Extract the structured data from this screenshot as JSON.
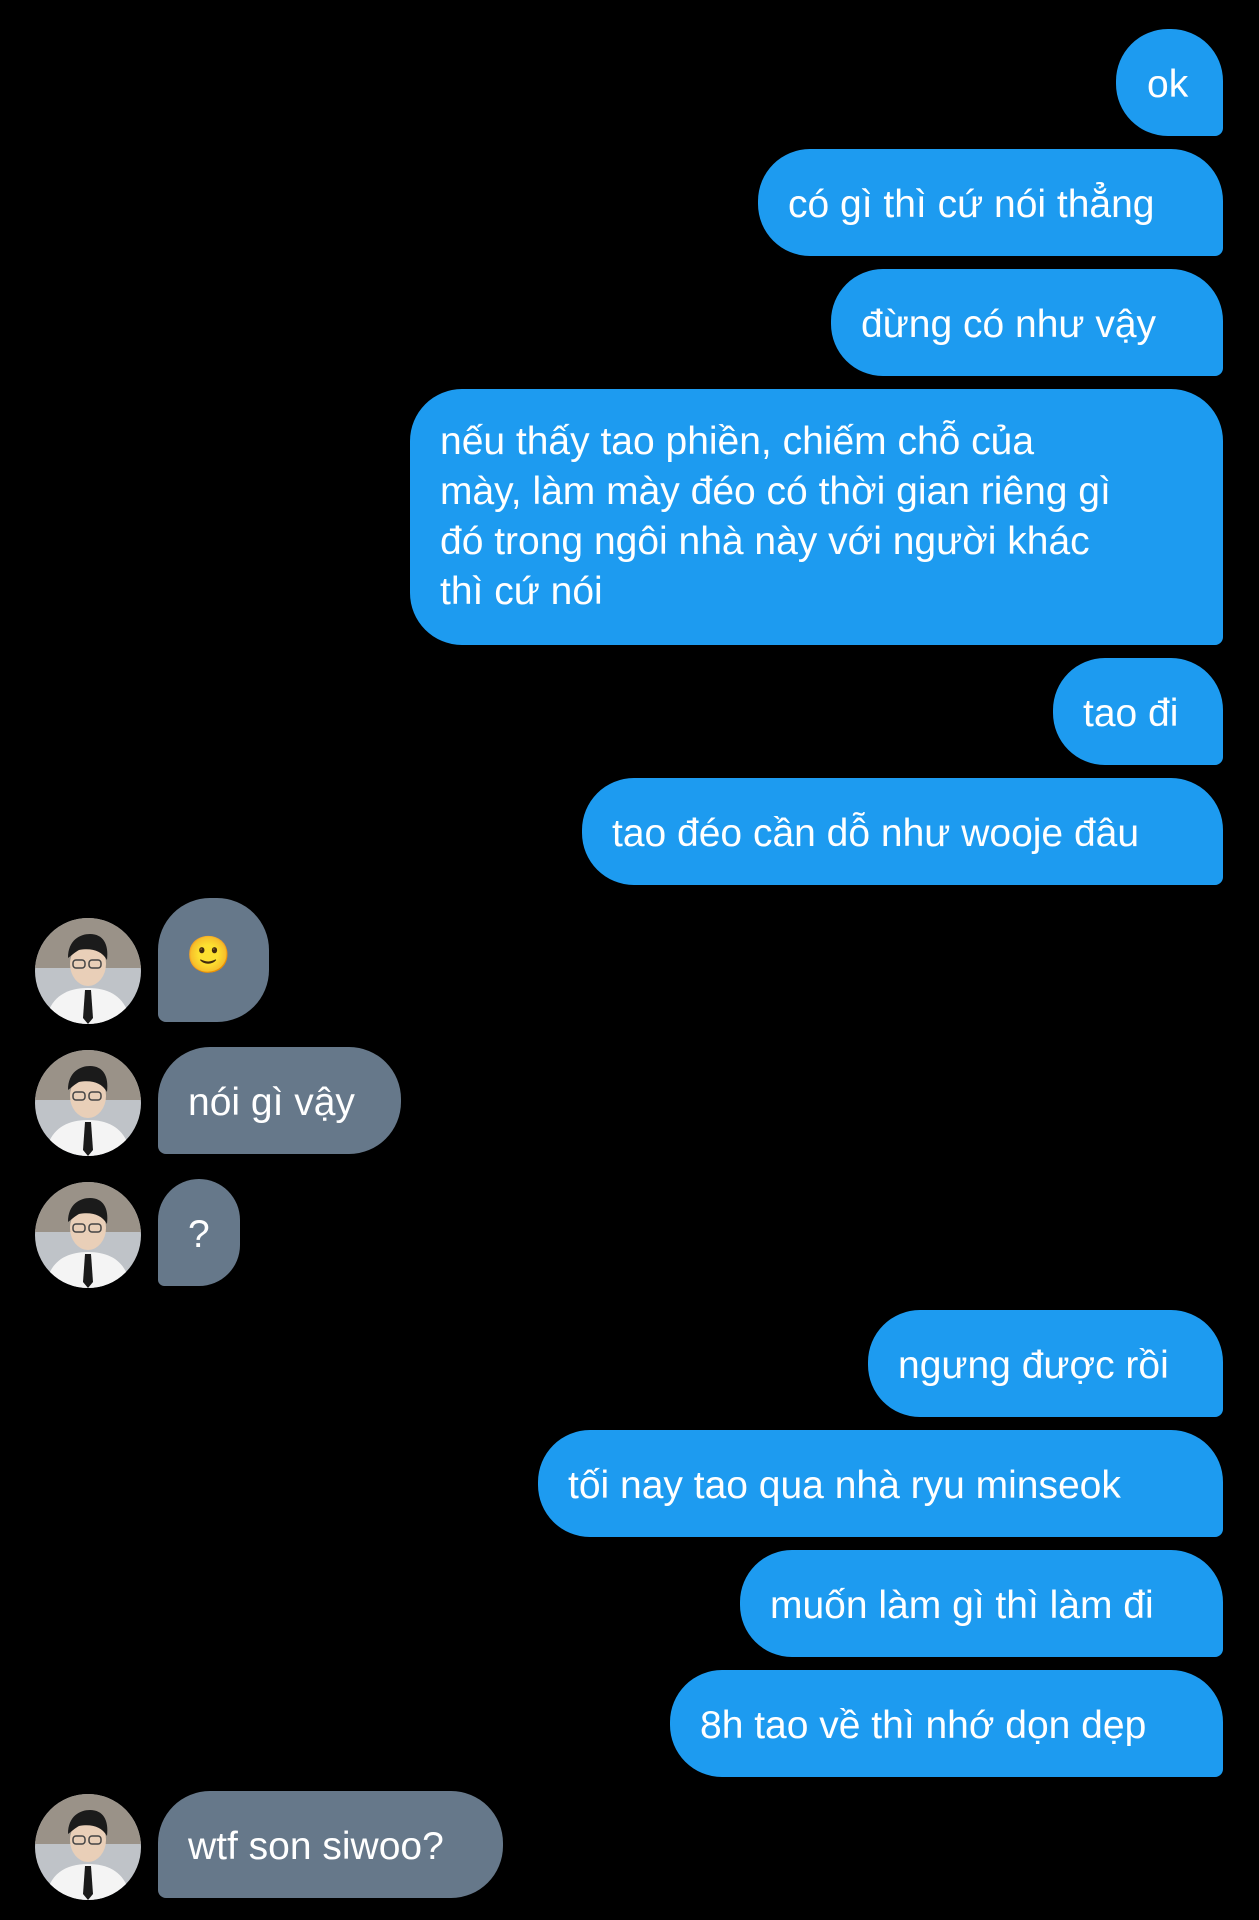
{
  "messages": {
    "m1": "ok",
    "m2": "có gì thì cứ nói thẳng",
    "m3": "đừng có như vậy",
    "m4_line1": "nếu thấy tao phiền, chiếm chỗ của",
    "m4_line2": "mày, làm mày đéo có thời gian riêng gì",
    "m4_line3": "đó trong ngôi nhà này với người khác",
    "m4_line4": "thì cứ nói",
    "m5": "tao đi",
    "m6": "tao đéo cần dỗ như wooje đâu",
    "r1": "🙂",
    "r2": "nói gì vậy",
    "r3": "?",
    "m7": "ngưng được rồi",
    "m8": "tối nay tao qua nhà ryu minseok",
    "m9": "muốn làm gì thì làm đi",
    "m10": "8h tao về thì nhớ dọn dẹp",
    "r4": "wtf son siwoo?"
  },
  "colors": {
    "outgoing_bubble": "#1d9bf0",
    "incoming_bubble": "#66788a",
    "background": "#000000"
  },
  "icons": {
    "avatar": "user-avatar-photo"
  }
}
